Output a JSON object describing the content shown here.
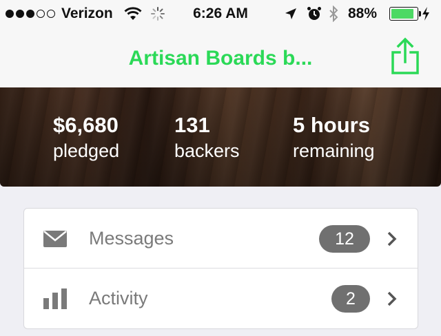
{
  "status_bar": {
    "carrier": "Verizon",
    "signal_filled": 3,
    "signal_total": 5,
    "time": "6:26 AM",
    "battery_percent": "88%",
    "battery_level": 0.88,
    "battery_color": "#4cd964"
  },
  "nav": {
    "title": "Artisan Boards b...",
    "accent_color": "#2bd957",
    "share_icon": "share-icon"
  },
  "project_stats": {
    "pledged": {
      "value": "$6,680",
      "label": "pledged"
    },
    "backers": {
      "value": "131",
      "label": "backers"
    },
    "remaining": {
      "value": "5 hours",
      "label": "remaining"
    }
  },
  "menu": {
    "items": [
      {
        "label": "Messages",
        "count": "12",
        "icon": "envelope-icon"
      },
      {
        "label": "Activity",
        "count": "2",
        "icon": "bar-chart-icon"
      }
    ]
  }
}
